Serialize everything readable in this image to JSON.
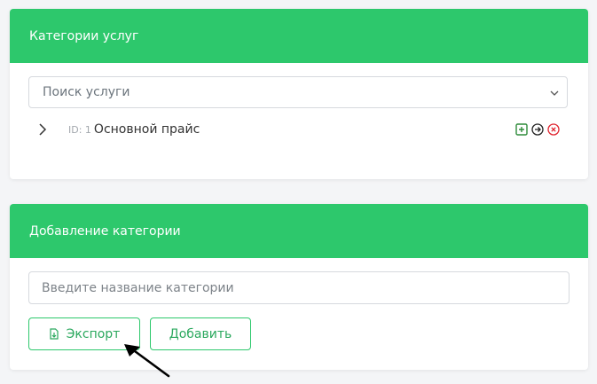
{
  "categories_card": {
    "title": "Категории услуг",
    "search_placeholder": "Поиск услуги",
    "tree": [
      {
        "id_label": "ID: 1",
        "name": "Основной прайс"
      }
    ],
    "action_icons": [
      "plus-square-icon",
      "arrow-circle-right-icon",
      "close-circle-icon"
    ]
  },
  "add_card": {
    "title": "Добавление категории",
    "name_placeholder": "Введите название категории",
    "export_label": "Экспорт",
    "add_label": "Добавить"
  },
  "colors": {
    "header_green": "#2dc86c",
    "button_text": "#2aa85d",
    "add_icon": "#2e8b3a",
    "delete_icon": "#e0242f"
  }
}
